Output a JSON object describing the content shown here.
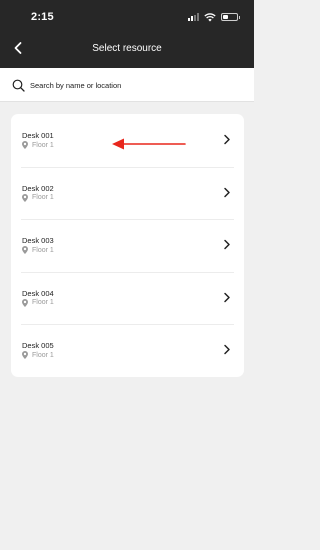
{
  "status_bar": {
    "time": "2:15"
  },
  "header": {
    "title": "Select resource"
  },
  "search": {
    "placeholder": "Search by name or location"
  },
  "resources": [
    {
      "name": "Desk 001",
      "location": "Floor 1"
    },
    {
      "name": "Desk 002",
      "location": "Floor 1"
    },
    {
      "name": "Desk 003",
      "location": "Floor 1"
    },
    {
      "name": "Desk 004",
      "location": "Floor 1"
    },
    {
      "name": "Desk 005",
      "location": "Floor 1"
    }
  ],
  "icons": {
    "back": "chevron-left-icon",
    "search": "search-icon",
    "location": "map-pin-icon",
    "row_action": "chevron-right-icon",
    "annotation": "red-arrow-left"
  },
  "colors": {
    "header_bg": "#272727",
    "page_bg": "#f0f0f0",
    "card_bg": "#ffffff",
    "annotation_arrow": "#e8261c"
  }
}
